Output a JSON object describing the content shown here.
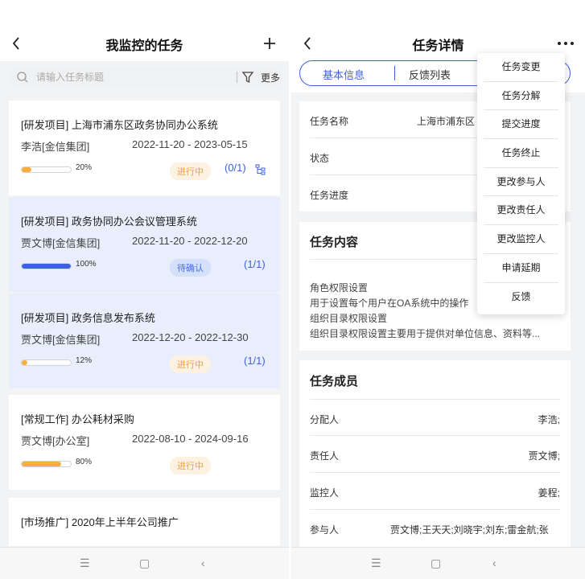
{
  "left": {
    "title": "我监控的任务",
    "search": {
      "placeholder": "请输入任务标题"
    },
    "more_label": "更多",
    "tasks": [
      {
        "title": "[研发项目] 上海市浦东区政务协同办公系统",
        "person": "李浩[金信集团]",
        "dates": "2022-11-20 - 2023-05-15",
        "progress": 20,
        "progress_label": "20%",
        "status": "进行中",
        "ratio": "(0/1)"
      },
      {
        "title": "[研发项目] 政务协同办公会议管理系统",
        "person": "贾文博[金信集团]",
        "dates": "2022-11-20 - 2022-12-20",
        "progress": 100,
        "progress_label": "100%",
        "status": "待确认",
        "ratio": "(1/1)"
      },
      {
        "title": "[研发项目] 政务信息发布系统",
        "person": "贾文博[金信集团]",
        "dates": "2022-12-20 - 2022-12-30",
        "progress": 12,
        "progress_label": "12%",
        "status": "进行中",
        "ratio": "(1/1)"
      },
      {
        "title": "[常规工作] 办公耗材采购",
        "person": "贾文博[办公室]",
        "dates": "2022-08-10 - 2024-09-16",
        "progress": 80,
        "progress_label": "80%",
        "status": "进行中",
        "ratio": ""
      },
      {
        "title": "[市场推广] 2020年上半年公司推广",
        "person": "",
        "dates": "",
        "progress": null,
        "progress_label": "",
        "status": "",
        "ratio": ""
      }
    ]
  },
  "right": {
    "title": "任务详情",
    "tabs": [
      "基本信息",
      "反馈列表"
    ],
    "basic": {
      "name_label": "任务名称",
      "name_value": "上海市浦东区",
      "status_label": "状态",
      "progress_label": "任务进度"
    },
    "content": {
      "title": "任务内容",
      "lines": [
        "角色权限设置",
        "用于设置每个用户在OA系统中的操作",
        "组织目录权限设置",
        "组织目录权限设置主要用于提供对单位信息、资料等..."
      ]
    },
    "members": {
      "title": "任务成员",
      "rows": [
        {
          "label": "分配人",
          "value": "李浩;"
        },
        {
          "label": "责任人",
          "value": "贾文博;"
        },
        {
          "label": "监控人",
          "value": "姜程;"
        },
        {
          "label": "参与人",
          "value": "贾文博;王天天;刘晓宇;刘东;雷金航;张"
        }
      ]
    },
    "menu": [
      "任务变更",
      "任务分解",
      "提交进度",
      "任务终止",
      "更改参与人",
      "更改责任人",
      "更改监控人",
      "申请延期",
      "反馈"
    ]
  },
  "colors": {
    "accent": "#3d63dc",
    "orange": "#f7ae3f",
    "selected_bg": "#e9eefc"
  }
}
